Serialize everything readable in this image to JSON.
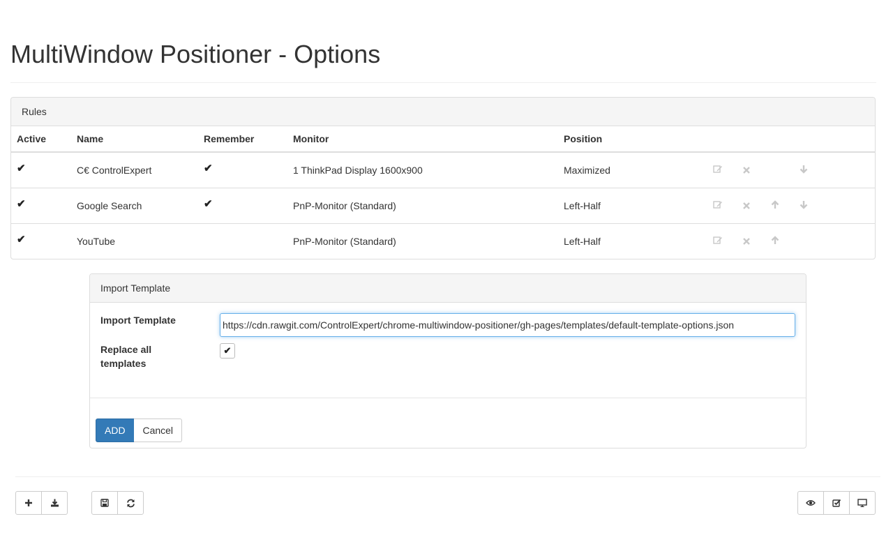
{
  "header": {
    "title": "MultiWindow Positioner - Options"
  },
  "rules": {
    "heading": "Rules",
    "columns": [
      "Active",
      "Name",
      "Remember",
      "Monitor",
      "Position"
    ],
    "rows": [
      {
        "active": "✔",
        "name": "C€ ControlExpert",
        "remember": "✔",
        "monitor": "1 ThinkPad Display 1600x900",
        "position": "Maximized",
        "up": false,
        "down": true
      },
      {
        "active": "✔",
        "name": "Google Search",
        "remember": "✔",
        "monitor": "PnP-Monitor (Standard)",
        "position": "Left-Half",
        "up": true,
        "down": true
      },
      {
        "active": "✔",
        "name": "YouTube",
        "remember": "",
        "monitor": "PnP-Monitor (Standard)",
        "position": "Left-Half",
        "up": true,
        "down": false
      }
    ],
    "icons": {
      "edit": "edit-icon",
      "delete": "delete-icon",
      "up": "arrow-up-icon",
      "down": "arrow-down-icon"
    }
  },
  "import": {
    "heading": "Import Template",
    "url_label": "Import Template",
    "url_value": "https://cdn.rawgit.com/ControlExpert/chrome-multiwindow-positioner/gh-pages/templates/default-template-options.json",
    "replace_label": "Replace all templates",
    "replace_checked": "✔",
    "add_label": "ADD",
    "cancel_label": "Cancel"
  },
  "footer": {
    "left_group_1": [
      "plus-icon",
      "download-icon"
    ],
    "left_group_2": [
      "save-icon",
      "refresh-icon"
    ],
    "right_group": [
      "eye-icon",
      "checkbox-icon",
      "monitor-icon"
    ]
  },
  "colors": {
    "primary": "#337ab7",
    "focus": "#66afe9",
    "muted_icon": "#c8c8c8"
  }
}
